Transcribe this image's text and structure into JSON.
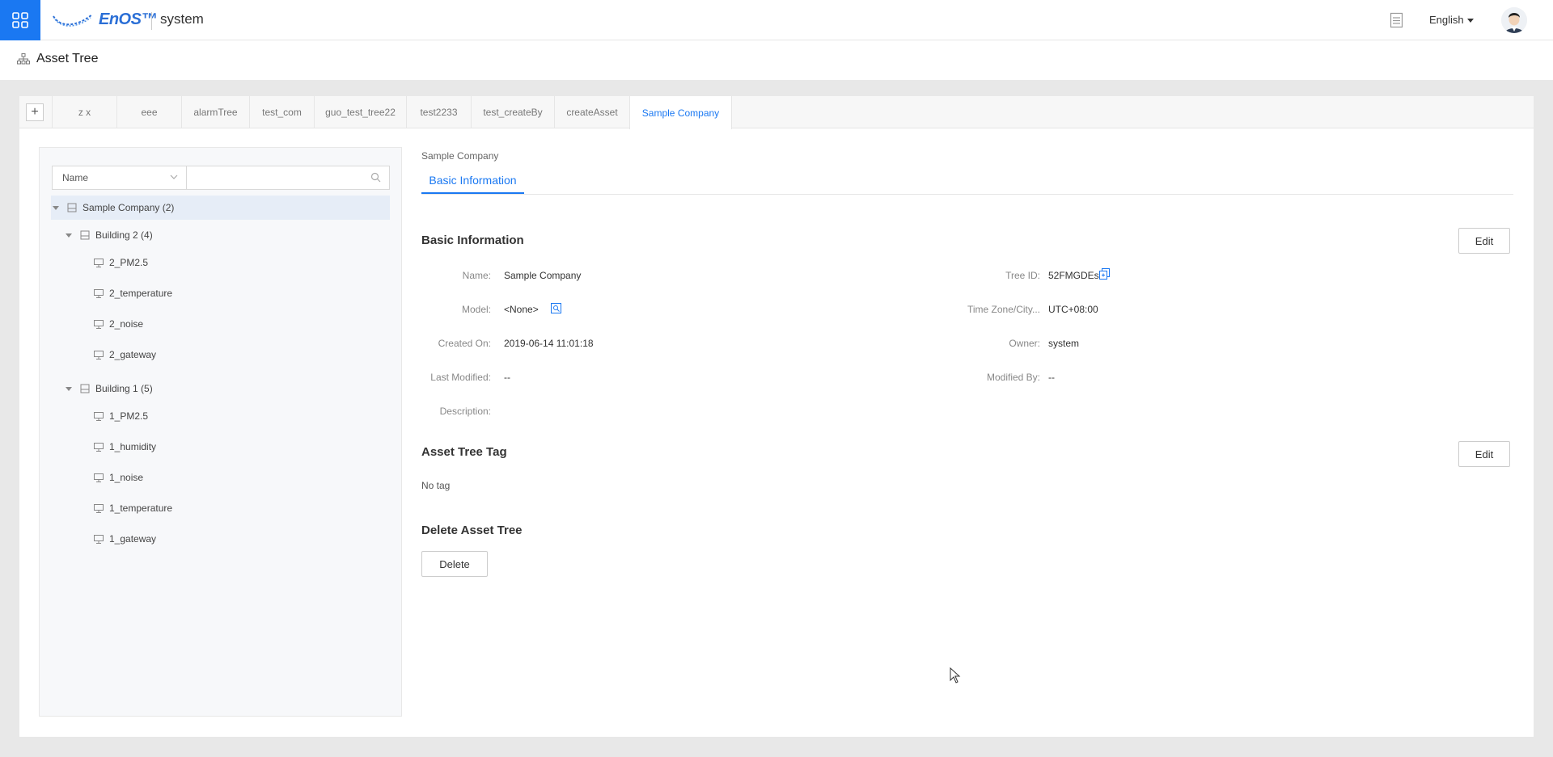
{
  "topbar": {
    "apps_icon": "grid-icon",
    "logo_text": "EnOS™",
    "app_name": "system",
    "doc_icon": "document-icon",
    "language": "English"
  },
  "page": {
    "title": "Asset Tree",
    "title_icon": "hierarchy-icon"
  },
  "tabs": {
    "add_label": "+",
    "items": [
      "z x",
      "eee",
      "alarmTree",
      "test_com",
      "guo_test_tree22",
      "test2233",
      "test_createBy",
      "createAsset",
      "Sample Company"
    ],
    "active": "Sample Company"
  },
  "tree_search": {
    "field": "Name",
    "query": ""
  },
  "tree": {
    "root": "Sample Company (2)",
    "building2": {
      "label": "Building 2 (4)",
      "children": [
        "2_PM2.5",
        "2_temperature",
        "2_noise",
        "2_gateway"
      ]
    },
    "building1": {
      "label": "Building 1 (5)",
      "children": [
        "1_PM2.5",
        "1_humidity",
        "1_noise",
        "1_temperature",
        "1_gateway"
      ]
    }
  },
  "detail": {
    "breadcrumb": "Sample Company",
    "tab": "Basic Information",
    "basic": {
      "title": "Basic Information",
      "edit_label": "Edit",
      "name_label": "Name:",
      "name": "Sample Company",
      "model_label": "Model:",
      "model": "<None>",
      "created_label": "Created On:",
      "created": "2019-06-14 11:01:18",
      "modified_label": "Last Modified:",
      "modified": "--",
      "description_label": "Description:",
      "description": "",
      "tree_id_label": "Tree ID:",
      "tree_id": "52FMGDEs",
      "timezone_label": "Time Zone/City...",
      "timezone": "UTC+08:00",
      "owner_label": "Owner:",
      "owner": "system",
      "modified_by_label": "Modified By:",
      "modified_by": "--"
    },
    "tag": {
      "title": "Asset Tree Tag",
      "edit_label": "Edit",
      "empty": "No tag"
    },
    "delete": {
      "title": "Delete Asset Tree",
      "button": "Delete"
    }
  },
  "colors": {
    "accent": "#1a78f2",
    "selected_row": "#e6edf7"
  }
}
